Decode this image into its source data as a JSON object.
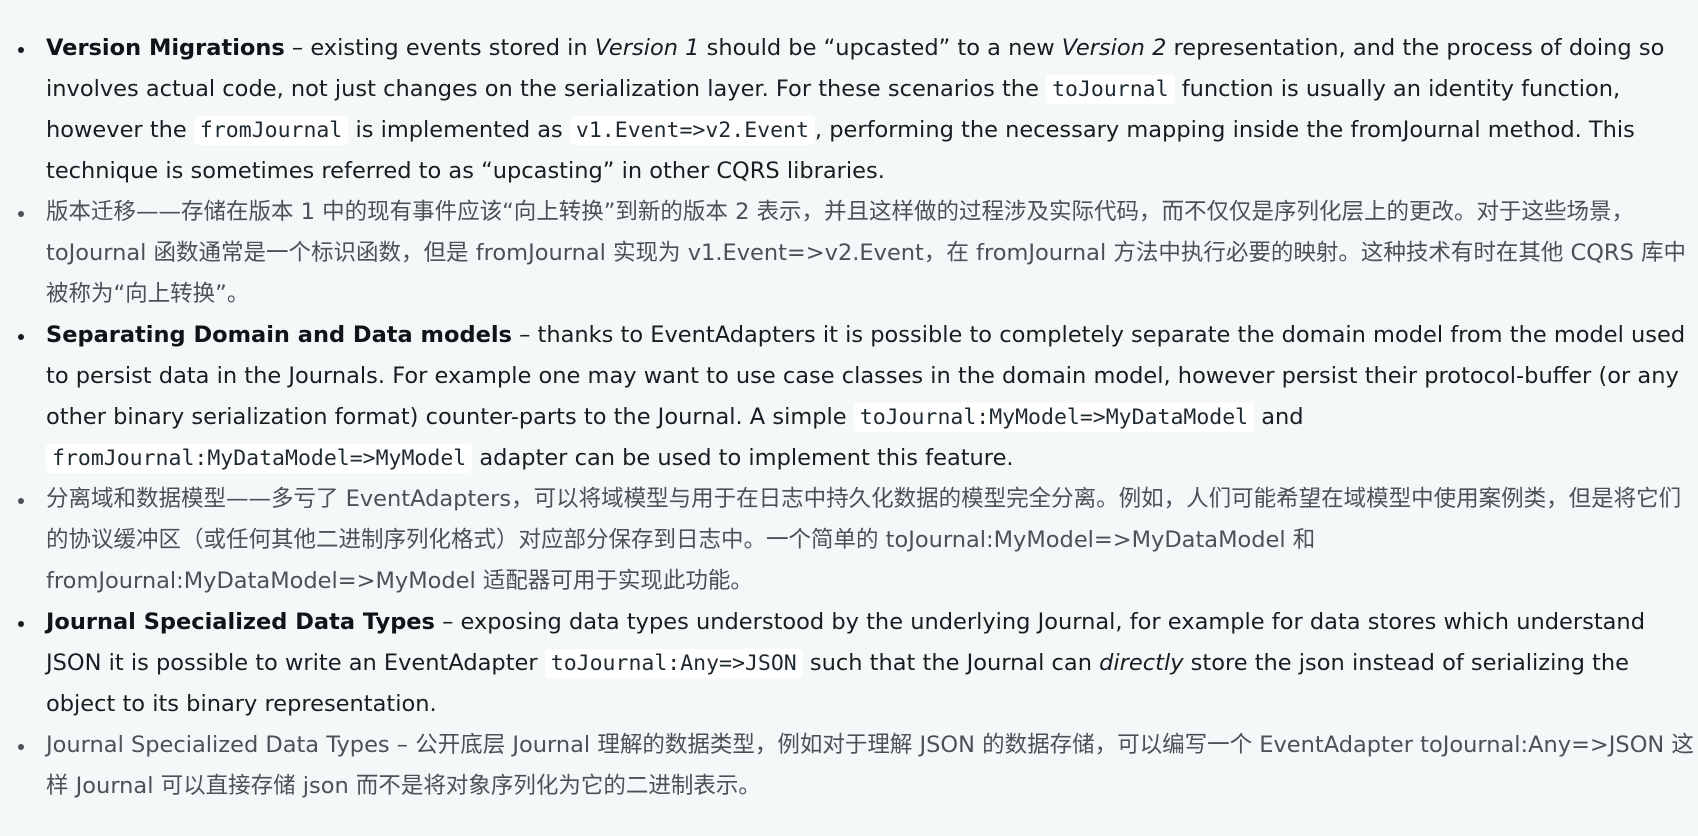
{
  "items": [
    {
      "lang": "en",
      "term": "Version Migrations",
      "t1": " – existing events stored in ",
      "e1": "Version 1",
      "t2": " should be “upcasted” to a new ",
      "e2": "Version 2",
      "t3": " representation, and the process of doing so involves actual code, not just changes on the serialization layer. For these scenarios the ",
      "c1": "toJournal",
      "t4": " function is usually an identity function, however the ",
      "c2": "fromJournal",
      "t5": " is implemented as ",
      "c3": "v1.Event=>v2.Event",
      "t6": ", performing the necessary mapping inside the fromJournal method. This technique is sometimes referred to as “upcasting” in other CQRS libraries."
    },
    {
      "lang": "zh",
      "text": "版本迁移——存储在版本 1 中的现有事件应该“向上转换”到新的版本 2 表示，并且这样做的过程涉及实际代码，而不仅仅是序列化层上的更改。对于这些场景，toJournal 函数通常是一个标识函数，但是 fromJournal 实现为 v1.Event=>v2.Event，在 fromJournal 方法中执行必要的映射。这种技术有时在其他 CQRS 库中被称为“向上转换”。"
    },
    {
      "lang": "en",
      "term": "Separating Domain and Data models",
      "t1": " – thanks to EventAdapters it is possible to completely separate the domain model from the model used to persist data in the Journals. For example one may want to use case classes in the domain model, however persist their protocol-buffer (or any other binary serialization format) counter-parts to the Journal. A simple ",
      "c1": "toJournal:MyModel=>MyDataModel",
      "t2": " and ",
      "c2": "fromJournal:MyDataModel=>MyModel",
      "t3": " adapter can be used to implement this feature."
    },
    {
      "lang": "zh",
      "text": "分离域和数据模型——多亏了 EventAdapters，可以将域模型与用于在日志中持久化数据的模型完全分离。例如，人们可能希望在域模型中使用案例类，但是将它们的协议缓冲区（或任何其他二进制序列化格式）对应部分保存到日志中。一个简单的 toJournal:MyModel=>MyDataModel 和 fromJournal:MyDataModel=>MyModel 适配器可用于实现此功能。"
    },
    {
      "lang": "en",
      "term": "Journal Specialized Data Types",
      "t1": " – exposing data types understood by the underlying Journal, for example for data stores which understand JSON it is possible to write an EventAdapter ",
      "c1": "toJournal:Any=>JSON",
      "t2": " such that the Journal can ",
      "e1": "directly",
      "t3": " store the json instead of serializing the object to its binary representation."
    },
    {
      "lang": "zh",
      "text": "Journal Specialized Data Types – 公开底层 Journal 理解的数据类型，例如对于理解 JSON 的数据存储，可以编写一个 EventAdapter toJournal:Any=>JSON 这样 Journal 可以直接存储 json 而不是将对象序列化为它的二进制表示。"
    }
  ]
}
